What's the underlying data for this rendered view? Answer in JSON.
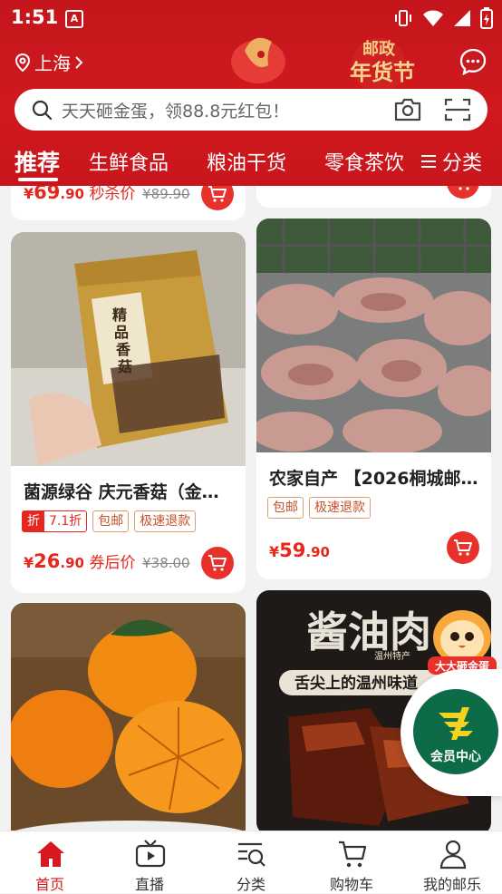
{
  "status_bar": {
    "time": "1:51",
    "app_badge": "A"
  },
  "header": {
    "location": "上海",
    "festival_banner": {
      "line1": "邮政",
      "line2": "年货节"
    },
    "search": {
      "placeholder": "天天砸金蛋，领88.8元红包！"
    },
    "tabs": [
      "推荐",
      "生鲜食品",
      "粮油干货",
      "零食茶饮"
    ],
    "active_tab": "推荐",
    "category_label": "分类"
  },
  "feed": {
    "partial_top_left": {
      "price_yen": "¥",
      "price_int": "69",
      "price_dec": ".90",
      "price_label": "秒杀价",
      "original_price": "¥89.90"
    },
    "products": [
      {
        "title": "菌源绿谷 庆元香菇（金…",
        "image_text": [
          "精",
          "品",
          "香",
          "菇"
        ],
        "discount": {
          "icon": "折",
          "value": "7.1折"
        },
        "tags": [
          "包邮",
          "极速退款"
        ],
        "price_yen": "¥",
        "price_int": "26",
        "price_dec": ".90",
        "price_label": "券后价",
        "original_price": "¥38.00"
      },
      {
        "title": "农家自产 【2026桐城邮…",
        "tags": [
          "包邮",
          "极速退款"
        ],
        "price_yen": "¥",
        "price_int": "59",
        "price_dec": ".90"
      },
      {
        "title": "",
        "image_desc": "persimmons"
      },
      {
        "title": "",
        "image_text": [
          "酱油肉",
          "温州特产",
          "舌尖上的温州味道"
        ]
      }
    ]
  },
  "floating": {
    "mascot_label": "大大砸金蛋",
    "member_label": "会员中心"
  },
  "bottom_nav": {
    "items": [
      {
        "label": "首页",
        "icon": "home-icon"
      },
      {
        "label": "直播",
        "icon": "live-tv-icon"
      },
      {
        "label": "分类",
        "icon": "category-search-icon"
      },
      {
        "label": "购物车",
        "icon": "cart-icon"
      },
      {
        "label": "我的邮乐",
        "icon": "profile-icon"
      }
    ],
    "active": "首页"
  },
  "colors": {
    "brand_red": "#d0191f",
    "price_red": "#e5271d",
    "member_green": "#0e6b47"
  }
}
